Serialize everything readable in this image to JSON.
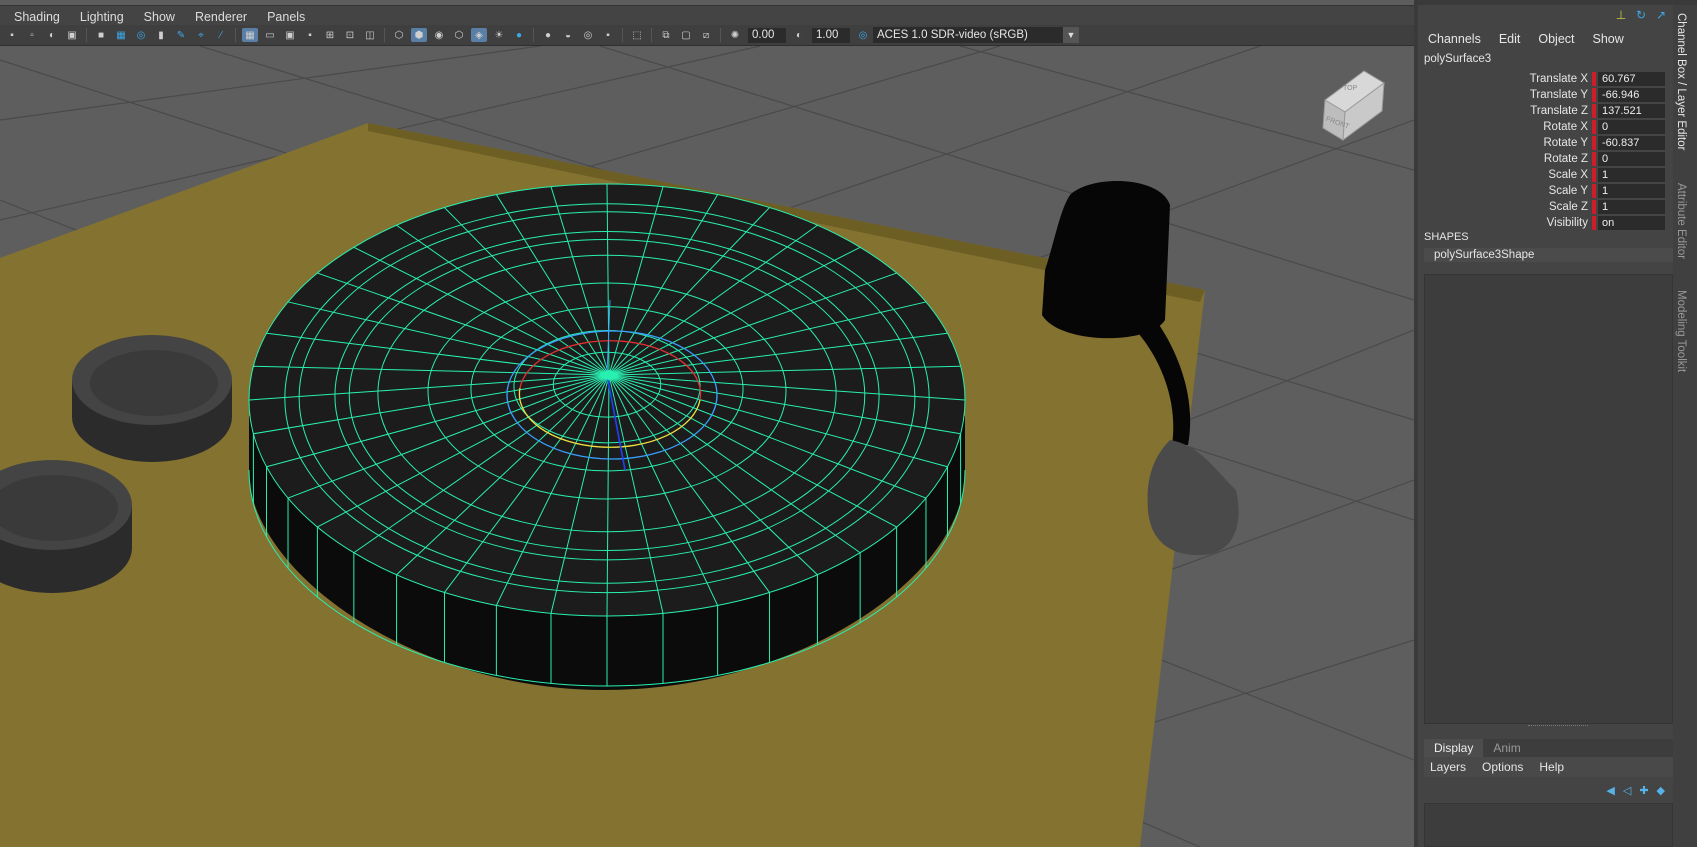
{
  "viewport": {
    "menus": [
      "Shading",
      "Lighting",
      "Show",
      "Renderer",
      "Panels"
    ],
    "exposure": "0.00",
    "gamma": "1.00",
    "color_space": "ACES 1.0 SDR-video (sRGB)",
    "view_cube": {
      "top": "TOP",
      "front": "FRONT"
    }
  },
  "channel_box": {
    "menus": [
      "Channels",
      "Edit",
      "Object",
      "Show"
    ],
    "object_name": "polySurface3",
    "attributes": [
      {
        "label": "Translate X",
        "value": "60.767"
      },
      {
        "label": "Translate Y",
        "value": "-66.946"
      },
      {
        "label": "Translate Z",
        "value": "137.521"
      },
      {
        "label": "Rotate X",
        "value": "0"
      },
      {
        "label": "Rotate Y",
        "value": "-60.837"
      },
      {
        "label": "Rotate Z",
        "value": "0"
      },
      {
        "label": "Scale X",
        "value": "1"
      },
      {
        "label": "Scale Y",
        "value": "1"
      },
      {
        "label": "Scale Z",
        "value": "1"
      },
      {
        "label": "Visibility",
        "value": "on"
      }
    ],
    "shapes_label": "SHAPES",
    "shape_name": "polySurface3Shape"
  },
  "layer_editor": {
    "tabs": [
      "Display",
      "Anim"
    ],
    "active_tab": "Display",
    "menus": [
      "Layers",
      "Options",
      "Help"
    ]
  },
  "side_tabs": [
    "Channel Box / Layer Editor",
    "Attribute Editor",
    "Modeling Toolkit"
  ],
  "colors": {
    "wireframe": "#28f0b0",
    "base": "#847230",
    "accent": "#d01c2a",
    "icon_blue": "#3ea7e6"
  }
}
